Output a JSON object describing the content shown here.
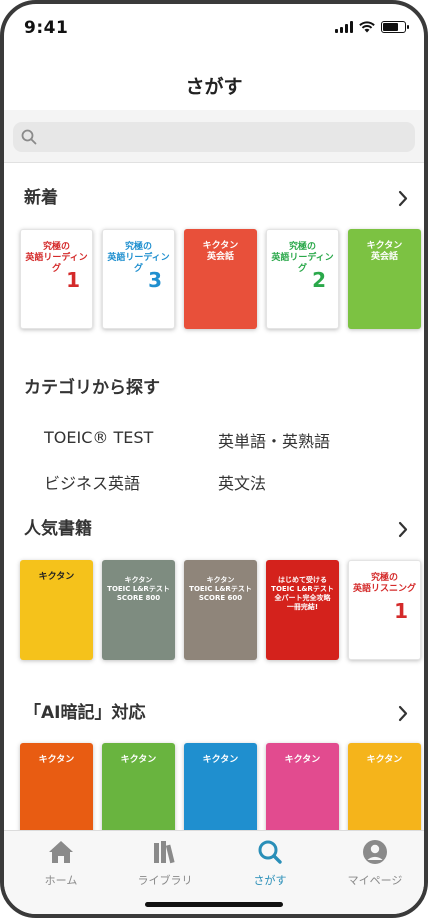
{
  "status": {
    "time": "9:41"
  },
  "header": {
    "title": "さがす"
  },
  "search": {
    "value": "",
    "placeholder": ""
  },
  "sections": {
    "new": {
      "title": "新着"
    },
    "category": {
      "title": "カテゴリから探す"
    },
    "popular": {
      "title": "人気書籍"
    },
    "ai": {
      "title": "「AI暗記」対応"
    }
  },
  "categories": [
    "TOEIC® TEST",
    "英単語・英熟語",
    "ビジネス英語",
    "英文法"
  ],
  "new_books": [
    {
      "title": "究極の\n英語リーディング",
      "num": "1",
      "color": "#ffffff",
      "accent": "#d42a2a"
    },
    {
      "title": "究極の\n英語リーディング",
      "num": "3",
      "color": "#ffffff",
      "accent": "#1f8fcf"
    },
    {
      "title": "キクタン\n英会話",
      "num": "",
      "color": "#e8503a",
      "accent": "#ffffff"
    },
    {
      "title": "究極の\n英語リーディング",
      "num": "2",
      "color": "#ffffff",
      "accent": "#2aa84a"
    },
    {
      "title": "キクタン\n英会話",
      "num": "",
      "color": "#7cc242",
      "accent": "#ffffff"
    }
  ],
  "popular_books": [
    {
      "title": "キクタン",
      "color": "#f5c21b",
      "accent": "#222222"
    },
    {
      "title": "キクタン\nTOEIC L&Rテスト\nSCORE 800",
      "color": "#7e8c80",
      "accent": "#ffffff"
    },
    {
      "title": "キクタン\nTOEIC L&Rテスト\nSCORE 600",
      "color": "#8f857a",
      "accent": "#ffffff"
    },
    {
      "title": "はじめて受ける\nTOEIC L&Rテスト\n全パート完全攻略\n一冊完結!",
      "color": "#d4221c",
      "accent": "#ffffff"
    },
    {
      "title": "究極の\n英語リスニング",
      "num": "1",
      "color": "#ffffff",
      "accent": "#d42a2a"
    }
  ],
  "ai_books": [
    {
      "title": "キクタン",
      "color": "#e85c12",
      "accent": "#ffffff"
    },
    {
      "title": "キクタン",
      "color": "#69b43f",
      "accent": "#ffffff"
    },
    {
      "title": "キクタン",
      "color": "#1f8fcf",
      "accent": "#ffffff"
    },
    {
      "title": "キクタン",
      "color": "#e24b8f",
      "accent": "#ffffff"
    },
    {
      "title": "キクタン",
      "color": "#f5b41b",
      "accent": "#ffffff"
    }
  ],
  "tabs": [
    {
      "label": "ホーム",
      "icon": "home-icon",
      "active": false
    },
    {
      "label": "ライブラリ",
      "icon": "library-icon",
      "active": false
    },
    {
      "label": "さがす",
      "icon": "search-icon",
      "active": true
    },
    {
      "label": "マイページ",
      "icon": "profile-icon",
      "active": false
    }
  ],
  "colors": {
    "accent": "#2a8fb8",
    "inactive": "#8a8a8a"
  }
}
